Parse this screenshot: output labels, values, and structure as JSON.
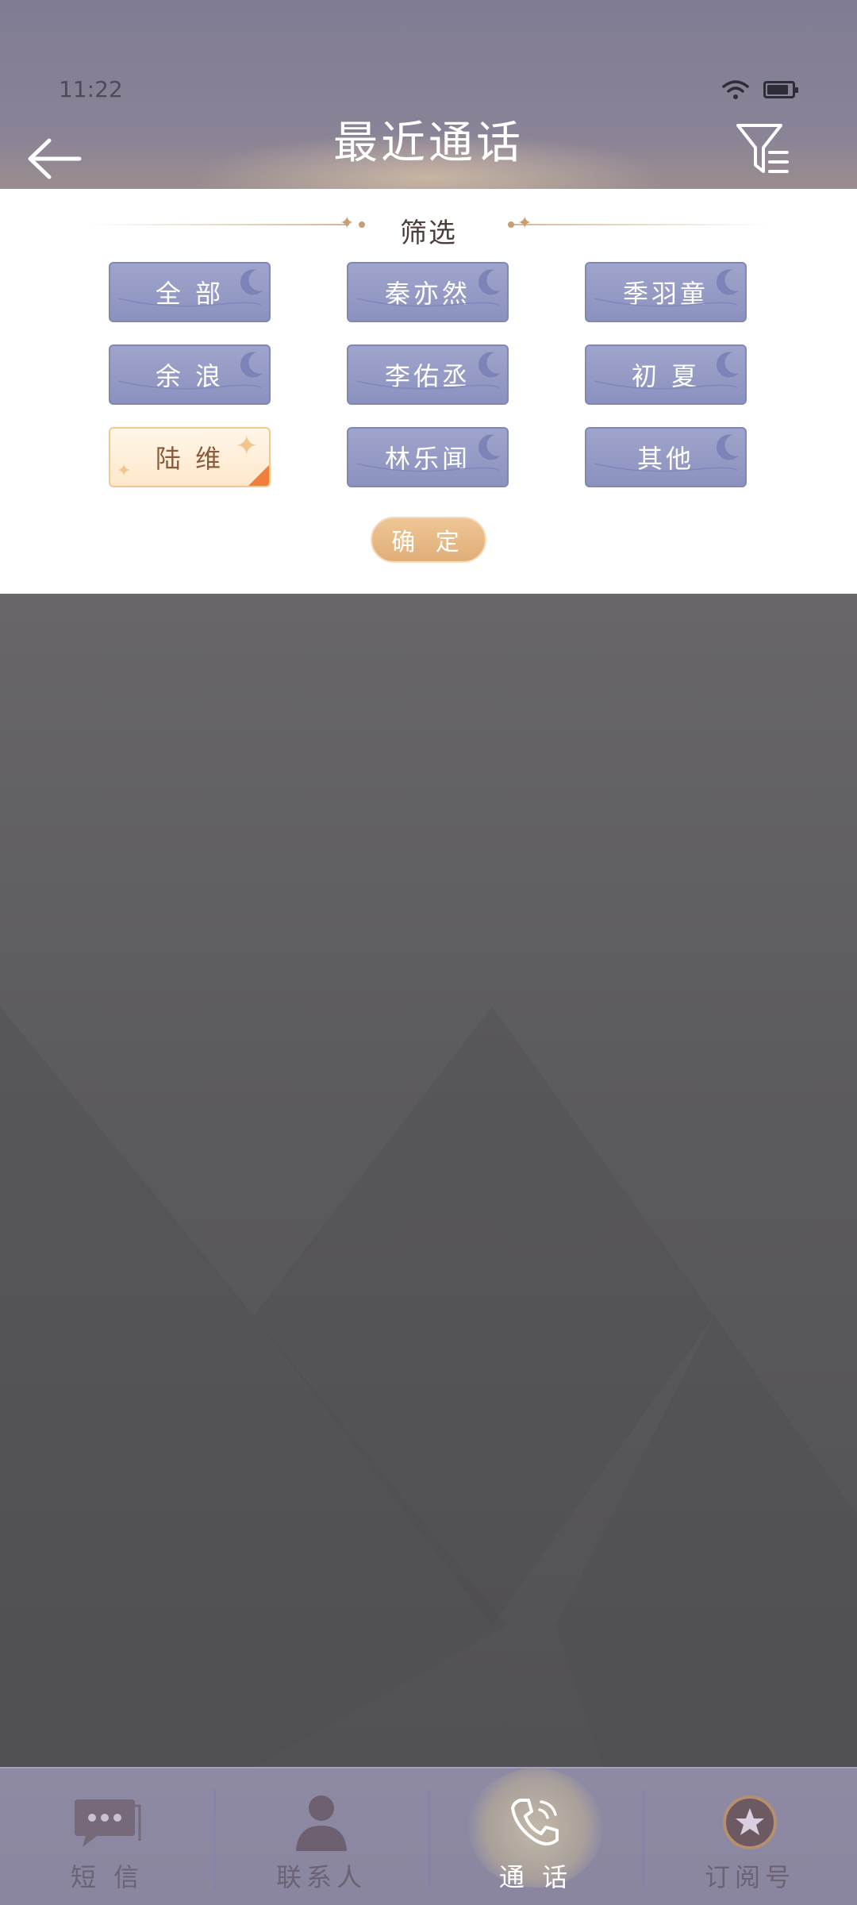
{
  "status_bar": {
    "time": "11:22"
  },
  "header": {
    "title": "最近通话"
  },
  "filter_panel": {
    "title": "筛选",
    "options": [
      {
        "label": "全 部",
        "selected": false
      },
      {
        "label": "秦亦然",
        "selected": false
      },
      {
        "label": "季羽童",
        "selected": false
      },
      {
        "label": "余 浪",
        "selected": false
      },
      {
        "label": "李佑丞",
        "selected": false
      },
      {
        "label": "初 夏",
        "selected": false
      },
      {
        "label": "陆 维",
        "selected": true
      },
      {
        "label": "林乐闻",
        "selected": false
      },
      {
        "label": "其他",
        "selected": false
      }
    ],
    "confirm_label": "确 定"
  },
  "bottom_nav": {
    "items": [
      {
        "label": "短 信",
        "icon": "message-icon",
        "active": false
      },
      {
        "label": "联系人",
        "icon": "contact-icon",
        "active": false
      },
      {
        "label": "通 话",
        "icon": "phone-icon",
        "active": true
      },
      {
        "label": "订阅号",
        "icon": "star-badge-icon",
        "active": false
      }
    ]
  },
  "colors": {
    "chip": "#9097c4",
    "chip_selected": "#fde8cc",
    "accent": "#e0ae78",
    "header": "#817d93"
  }
}
